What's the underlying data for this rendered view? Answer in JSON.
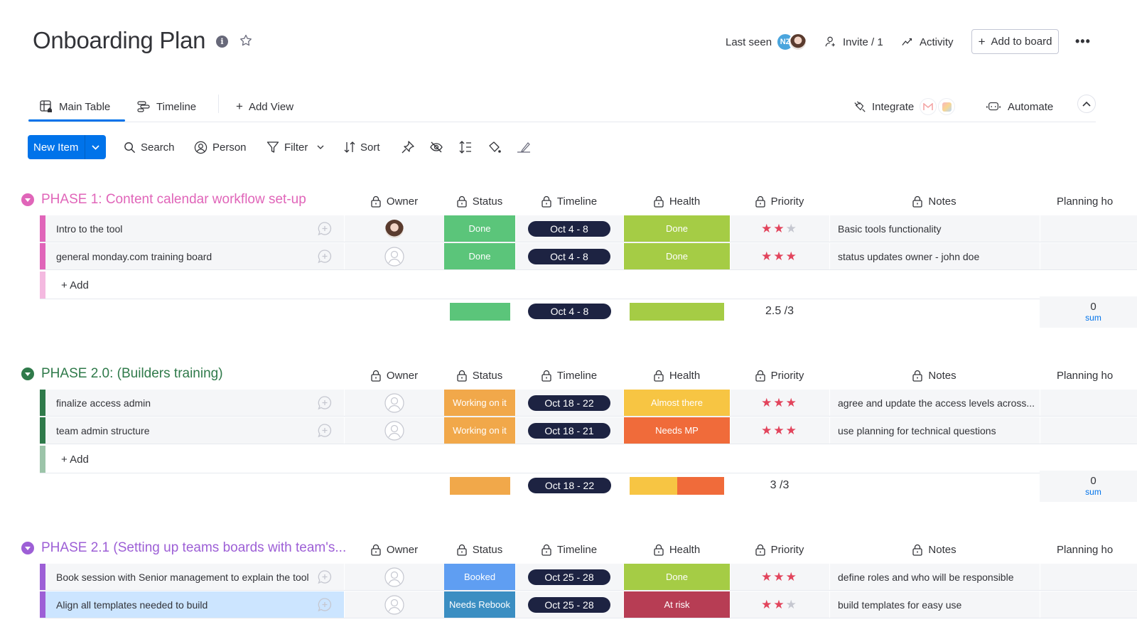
{
  "header": {
    "title": "Onboarding Plan",
    "last_seen_label": "Last seen",
    "avatar_initials": "NZ",
    "invite_label": "Invite / 1",
    "activity_label": "Activity",
    "add_to_board_label": "Add to board",
    "more_label": "•••"
  },
  "views": {
    "tabs": [
      {
        "label": "Main Table",
        "active": true
      },
      {
        "label": "Timeline",
        "active": false
      }
    ],
    "add_view_label": "Add View",
    "integrate_label": "Integrate",
    "automate_label": "Automate"
  },
  "toolbar": {
    "new_item_label": "New Item",
    "search_label": "Search",
    "person_label": "Person",
    "filter_label": "Filter",
    "sort_label": "Sort"
  },
  "columns": {
    "owner": "Owner",
    "status": "Status",
    "timeline": "Timeline",
    "health": "Health",
    "priority": "Priority",
    "notes": "Notes",
    "planning": "Planning ho"
  },
  "colors": {
    "accent": "#0073ea",
    "done": "#5bc57a",
    "health_done": "#a5cc45",
    "working": "#f1a84a",
    "almost": "#f7c543",
    "needs_mp": "#f06b3a",
    "booked": "#5f9ef2",
    "needs_rebook": "#3b8ec2",
    "at_risk": "#b73d54",
    "star_on": "#e2445c",
    "star_off": "#c5c7d0"
  },
  "groups": [
    {
      "title": "PHASE 1: Content calendar workflow set-up",
      "color": "#e065b9",
      "add_color": "#f4b9e0",
      "add_label": "+ Add",
      "items": [
        {
          "name": "Intro to the tool",
          "owner": "photo",
          "status": "Done",
          "status_color": "#5bc57a",
          "timeline": "Oct 4 - 8",
          "health": "Done",
          "health_color": "#a5cc45",
          "priority": 2,
          "notes": "Basic tools functionality"
        },
        {
          "name": "general monday.com training board",
          "owner": "empty",
          "status": "Done",
          "status_color": "#5bc57a",
          "timeline": "Oct 4 - 8",
          "health": "Done",
          "health_color": "#a5cc45",
          "priority": 3,
          "notes": "status updates owner - john doe"
        }
      ],
      "summary": {
        "status_segments": [
          {
            "color": "#5bc57a",
            "fraction": 1
          }
        ],
        "timeline": "Oct 4 - 8",
        "health_segments": [
          {
            "color": "#a5cc45",
            "fraction": 1
          }
        ],
        "priority": "2.5 /3",
        "planning_value": "0",
        "planning_label": "sum"
      }
    },
    {
      "title": "PHASE 2.0: (Builders training)",
      "color": "#2f7a4a",
      "add_color": "#9cc4a9",
      "add_label": "+ Add",
      "items": [
        {
          "name": "finalize access admin",
          "owner": "empty",
          "status": "Working on it",
          "status_color": "#f1a84a",
          "timeline": "Oct 18 - 22",
          "health": "Almost there",
          "health_color": "#f7c543",
          "priority": 3,
          "notes": "agree and update the access levels across..."
        },
        {
          "name": "team admin structure",
          "owner": "empty",
          "status": "Working on it",
          "status_color": "#f1a84a",
          "timeline": "Oct 18 - 21",
          "health": "Needs MP",
          "health_color": "#f06b3a",
          "priority": 3,
          "notes": "use planning for technical questions"
        }
      ],
      "summary": {
        "status_segments": [
          {
            "color": "#f1a84a",
            "fraction": 1
          }
        ],
        "timeline": "Oct 18 - 22",
        "health_segments": [
          {
            "color": "#f7c543",
            "fraction": 0.5
          },
          {
            "color": "#f06b3a",
            "fraction": 0.5
          }
        ],
        "priority": "3 /3",
        "planning_value": "0",
        "planning_label": "sum"
      }
    },
    {
      "title": "PHASE 2.1 (Setting up teams boards with team's...",
      "color": "#9d5fd6",
      "items": [
        {
          "name": "Book session with Senior management to explain the tool",
          "owner": "empty",
          "status": "Booked",
          "status_color": "#5f9ef2",
          "timeline": "Oct 25 - 28",
          "health": "Done",
          "health_color": "#a5cc45",
          "priority": 3,
          "notes": "define roles and who will be responsible"
        },
        {
          "name": "Align all templates needed to build",
          "owner": "empty",
          "status": "Needs Rebook",
          "status_color": "#3b8ec2",
          "timeline": "Oct 25 - 28",
          "health": "At risk",
          "health_color": "#b73d54",
          "priority": 2,
          "notes": "build templates for easy use",
          "selected": true
        }
      ]
    }
  ]
}
